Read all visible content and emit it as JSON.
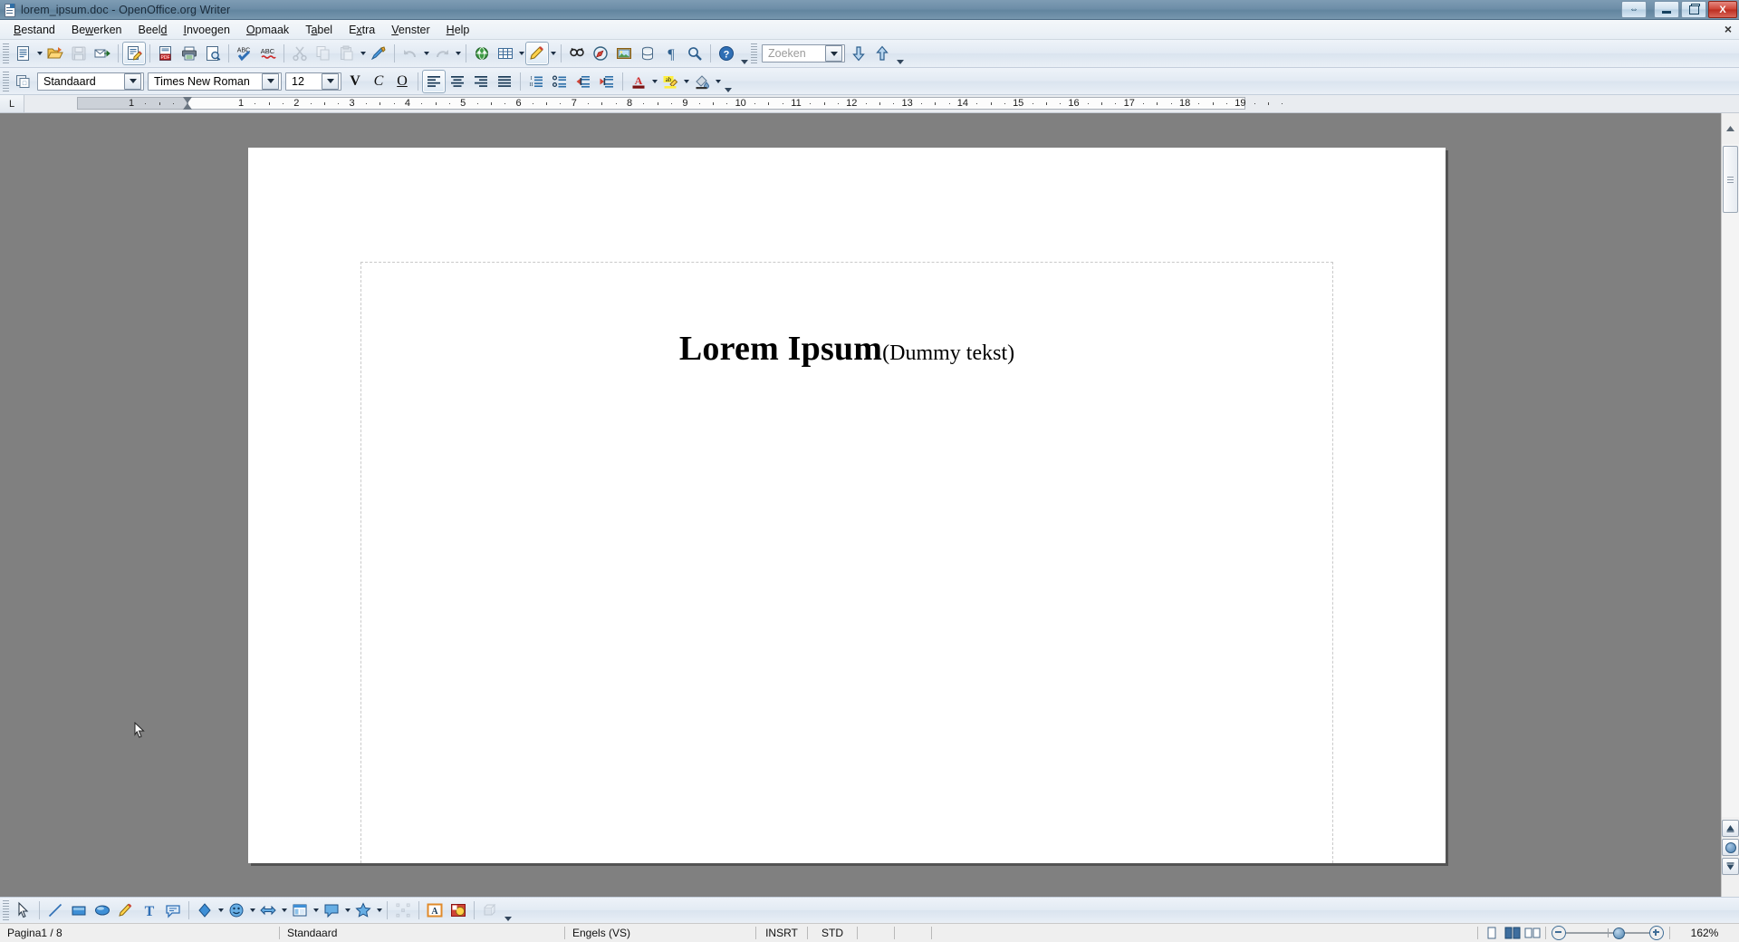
{
  "window": {
    "title": "lorem_ipsum.doc - OpenOffice.org Writer",
    "icon": "writer-document-icon",
    "controls": {
      "restore_label": "⇔",
      "minimize_label": "minimize",
      "maximize_label": "maximize",
      "close_label": "X"
    }
  },
  "menubar": {
    "items": [
      {
        "label": "Bestand",
        "accel": "B"
      },
      {
        "label": "Bewerken",
        "accel": "w"
      },
      {
        "label": "Beeld",
        "accel": "d"
      },
      {
        "label": "Invoegen",
        "accel": "I"
      },
      {
        "label": "Opmaak",
        "accel": "O"
      },
      {
        "label": "Tabel",
        "accel": "a"
      },
      {
        "label": "Extra",
        "accel": "x"
      },
      {
        "label": "Venster",
        "accel": "V"
      },
      {
        "label": "Help",
        "accel": "H"
      }
    ],
    "close_doc_label": "×"
  },
  "standard_toolbar": {
    "buttons": [
      {
        "name": "new-document",
        "label": "Nieuw"
      },
      {
        "name": "open-document",
        "label": "Openen"
      },
      {
        "name": "save-document",
        "label": "Opslaan"
      },
      {
        "name": "email-document",
        "label": "Document als e-mail"
      },
      {
        "name": "edit-file",
        "label": "Bestand bewerken"
      },
      {
        "name": "export-pdf",
        "label": "Direct als PDF exporteren"
      },
      {
        "name": "print-file",
        "label": "Bestand direct afdrukken"
      },
      {
        "name": "print-preview",
        "label": "Afdrukvoorbeeld"
      },
      {
        "name": "spelling-check",
        "label": "Spelling en grammatica"
      },
      {
        "name": "autospellcheck",
        "label": "Automatische spellingcontrole"
      },
      {
        "name": "cut",
        "label": "Knippen"
      },
      {
        "name": "copy",
        "label": "Kopiëren"
      },
      {
        "name": "paste",
        "label": "Plakken"
      },
      {
        "name": "clone-formatting",
        "label": "Opmaak klonen"
      },
      {
        "name": "undo",
        "label": "Ongedaan maken"
      },
      {
        "name": "redo",
        "label": "Opnieuw"
      },
      {
        "name": "hyperlink",
        "label": "Hyperlink"
      },
      {
        "name": "insert-table",
        "label": "Tabel"
      },
      {
        "name": "show-draw-functions",
        "label": "Tekenfuncties weergeven"
      },
      {
        "name": "find-replace",
        "label": "Zoeken en vervangen"
      },
      {
        "name": "navigator",
        "label": "Navigator"
      },
      {
        "name": "insert-image",
        "label": "Afbeelding uit bestand"
      },
      {
        "name": "data-sources",
        "label": "Gegevensbronnen"
      },
      {
        "name": "formatting-marks",
        "label": "Formatteringstekens"
      },
      {
        "name": "zoom",
        "label": "Zoomen"
      },
      {
        "name": "help",
        "label": "OpenOffice.org Help"
      }
    ],
    "search": {
      "placeholder": "Zoeken",
      "value": ""
    },
    "search_down_label": "Volgende zoeken",
    "search_up_label": "Vorige zoeken"
  },
  "formatting_toolbar": {
    "paragraph_style": "Standaard",
    "font_name": "Times New Roman",
    "font_size": "12",
    "bold_label": "V",
    "italic_label": "C",
    "underline_label": "O",
    "buttons": [
      {
        "name": "align-left",
        "label": "Links uitlijnen",
        "active": true
      },
      {
        "name": "align-center",
        "label": "Gecentreerd",
        "active": false
      },
      {
        "name": "align-right",
        "label": "Rechts uitlijnen",
        "active": false
      },
      {
        "name": "align-justified",
        "label": "Uitvullen",
        "active": false
      },
      {
        "name": "ordered-list",
        "label": "Nummering aan/uit",
        "active": false
      },
      {
        "name": "unordered-list",
        "label": "Opsommingstekens aan/uit",
        "active": false
      },
      {
        "name": "decrease-indent",
        "label": "Inspringing verkleinen",
        "active": false
      },
      {
        "name": "increase-indent",
        "label": "Inspringing vergroten",
        "active": false
      },
      {
        "name": "font-color",
        "label": "Tekenkleur",
        "active": false
      },
      {
        "name": "highlighting",
        "label": "Markeren",
        "active": false
      },
      {
        "name": "background-color",
        "label": "Achtergrondkleur",
        "active": false
      }
    ]
  },
  "ruler": {
    "tab_selector": "L",
    "unit": "cm",
    "numbers": [
      1,
      1,
      2,
      3,
      4,
      5,
      6,
      7,
      8,
      9,
      10,
      11,
      12,
      13,
      14,
      15,
      16,
      17,
      18,
      19
    ]
  },
  "document": {
    "heading": "Lorem Ipsum",
    "subtitle": "(Dummy tekst)"
  },
  "drawing_toolbar": {
    "buttons": [
      {
        "name": "select",
        "label": "Selecteren"
      },
      {
        "name": "line",
        "label": "Lijn"
      },
      {
        "name": "rectangle",
        "label": "Rechthoek"
      },
      {
        "name": "ellipse",
        "label": "Ellips"
      },
      {
        "name": "freeform-line",
        "label": "Lijn uit de vrije hand"
      },
      {
        "name": "text-box",
        "label": "Tekst"
      },
      {
        "name": "callout",
        "label": "Toelichting"
      },
      {
        "name": "basic-shapes",
        "label": "Standaardvormen"
      },
      {
        "name": "symbol-shapes",
        "label": "Symboolvormen"
      },
      {
        "name": "block-arrows",
        "label": "Blokpijlen"
      },
      {
        "name": "flowchart",
        "label": "Stroomdiagrammen"
      },
      {
        "name": "callout-shapes",
        "label": "Toelichtingen"
      },
      {
        "name": "stars",
        "label": "Sterren"
      },
      {
        "name": "points",
        "label": "Punten"
      },
      {
        "name": "fontwork-gallery",
        "label": "Fontwork Gallery"
      },
      {
        "name": "from-file",
        "label": "Uit bestand"
      },
      {
        "name": "extrusion-on-off",
        "label": "Extrusie aan/uit"
      }
    ]
  },
  "statusbar": {
    "page": "Pagina1 / 8",
    "page_style": "Standaard",
    "language": "Engels (VS)",
    "insert_mode": "INSRT",
    "selection_mode": "STD",
    "zoom": "162%",
    "view_single": "Enkele-paginaweergave",
    "view_multi": "Multipaginaweergave",
    "view_book": "Boekweergave"
  },
  "colors": {
    "title_bar": "#6e8ea8",
    "toolbar": "#e2eaf3",
    "canvas": "#808080",
    "page": "#ffffff",
    "close_button": "#cf4436",
    "accent": "#3f6d96"
  }
}
